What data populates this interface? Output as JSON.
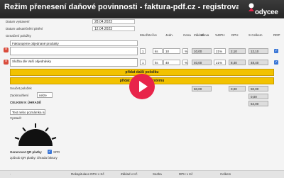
{
  "window": {
    "title": "Režim přenesení daňové povinnosti - faktura-pdf.cz - registrovaná verze"
  },
  "brand": {
    "name": "odycee"
  },
  "header_fields": {
    "issue_label": "Datum vystavení",
    "issue_value": "28.04.2023",
    "taxable_label": "Datum uskutečnění plnění",
    "taxable_value": "12.04.2023",
    "order_label": "Označení položky",
    "order_value": ""
  },
  "columns": [
    "Množství ks",
    "Jedn.",
    "Cena",
    "Sleva",
    "Základ",
    "%DPH",
    "DPH",
    "S Celkem",
    "RDP"
  ],
  "items": [
    {
      "description": "Fakturujeme objednané produkty",
      "qty": "",
      "unit": "",
      "price": "",
      "discount": "",
      "base": "",
      "vat_rate": "",
      "vat": "",
      "total": ""
    },
    {
      "description": "",
      "qty": "1",
      "unit": "ks",
      "price": "10",
      "discount": "%",
      "base": "10,00",
      "vat_rate": "21%",
      "vat": "2,10",
      "total": "12,10"
    },
    {
      "description": "Služba dle Vaší objednávky",
      "qty": "1",
      "unit": "ks",
      "price": "40",
      "discount": "%",
      "base": "40,00",
      "vat_rate": "21%",
      "vat": "8,40",
      "total": "48,40"
    }
  ],
  "actions": {
    "add_item": "přidat další položku",
    "add_from_system": "přidat položku ze systému"
  },
  "totals": {
    "sum_label": "Součet položek",
    "rounding_label": "Zaokrouhlení",
    "rounding_value": "nelze",
    "grand_label": "CELKEM K ÚHRADĚ",
    "base_total": "50,00",
    "vat_total": "0,00",
    "sum_total": "50,00",
    "grand_total": "54,00",
    "extra_total": "0,00"
  },
  "notes": {
    "placeholder": "Text nebo poznámka na faktuře",
    "issued_by": "Vystavil:"
  },
  "footer": {
    "qr_label": "Generovat QR platby",
    "qr_type": "SPD",
    "payment_qr": "způsob QR platby: ",
    "payment_qr_value": "úhrada faktury",
    "summary": [
      "Rekapitulace DPH v Kč",
      "Základ v Kč",
      "Sazba",
      "DPH v Kč",
      "Celkem"
    ]
  },
  "colors": {
    "title_bg": "#1f1f1f",
    "accent": "#f2c200",
    "play": "#e8244a",
    "delete": "#d94b3b"
  }
}
